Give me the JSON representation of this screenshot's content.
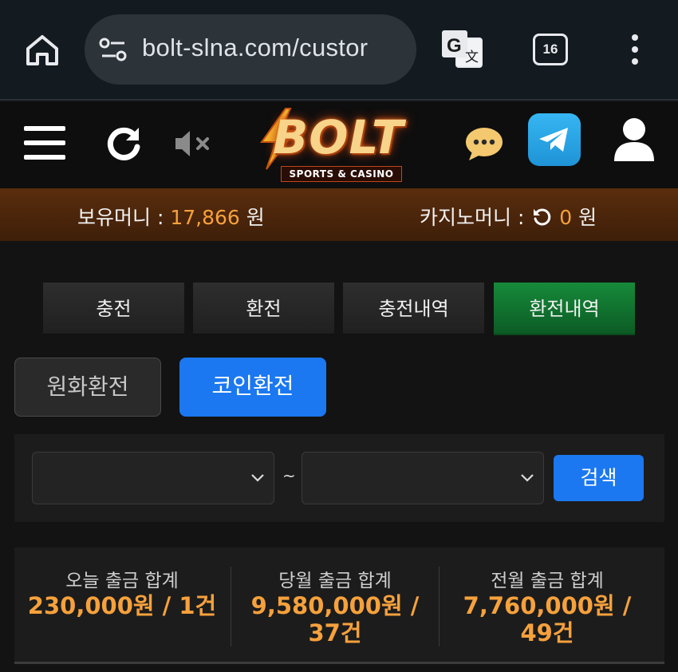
{
  "browser": {
    "url": "bolt-slna.com/custor",
    "tab_count": "16"
  },
  "header": {
    "logo_main": "BOLT",
    "logo_sub": "SPORTS & CASINO"
  },
  "money": {
    "hold_label": "보유머니 : ",
    "hold_value": "17,866",
    "hold_unit": " 원",
    "casino_label": "카지노머니 : ",
    "casino_value": "0",
    "casino_unit": " 원"
  },
  "tabs": [
    "충전",
    "환전",
    "충전내역",
    "환전내역"
  ],
  "sub_tabs": [
    "원화환전",
    "코인환전"
  ],
  "search": {
    "separator": "~",
    "button": "검색"
  },
  "summary": [
    {
      "label": "오늘 출금 합계",
      "value": "230,000원 / 1건"
    },
    {
      "label": "당월 출금 합계",
      "value": "9,580,000원 / 37건"
    },
    {
      "label": "전월 출금 합계",
      "value": "7,760,000원 / 49건"
    }
  ],
  "colors": {
    "accent_blue": "#1b78f0",
    "active_green": "#168a3a",
    "money_orange": "#f6a13c"
  }
}
